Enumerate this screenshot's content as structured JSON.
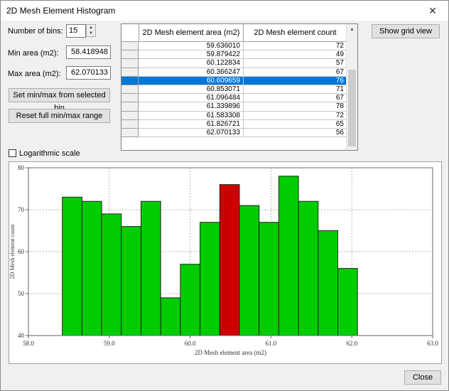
{
  "window": {
    "title": "2D Mesh Element Histogram",
    "close_glyph": "✕"
  },
  "controls": {
    "bins_label": "Number of bins:",
    "bins_value": "15",
    "min_label": "Min area (m2):",
    "min_value": "58.418948",
    "max_label": "Max area (m2):",
    "max_value": "62.070133",
    "set_minmax_button": "Set min/max from selected bin",
    "reset_button": "Reset full min/max range",
    "show_grid_button": "Show grid view",
    "log_label": "Logarithmic scale",
    "close_button": "Close"
  },
  "table": {
    "col1": "2D Mesh element area (m2)",
    "col2": "2D Mesh element count",
    "rows": [
      {
        "area": "59.636010",
        "count": "72"
      },
      {
        "area": "59.879422",
        "count": "49"
      },
      {
        "area": "60.122834",
        "count": "57"
      },
      {
        "area": "60.366247",
        "count": "67"
      },
      {
        "area": "60.609659",
        "count": "76"
      },
      {
        "area": "60.853071",
        "count": "71"
      },
      {
        "area": "61.096484",
        "count": "67"
      },
      {
        "area": "61.339896",
        "count": "78"
      },
      {
        "area": "61.583308",
        "count": "72"
      },
      {
        "area": "61.826721",
        "count": "65"
      },
      {
        "area": "62.070133",
        "count": "56"
      }
    ],
    "selected_index": 4
  },
  "colors": {
    "bar": "#00cc00",
    "bar_selected": "#cc0000",
    "selection": "#0078d7"
  },
  "chart_data": {
    "type": "bar",
    "xlabel": "2D Mesh element area (m2)",
    "ylabel": "2D Mesh element count",
    "xlim": [
      58.0,
      63.0
    ],
    "ylim": [
      40,
      80
    ],
    "xticks": [
      "58.0",
      "59.0",
      "60.0",
      "61.0",
      "62.0",
      "63.0"
    ],
    "yticks": [
      "40",
      "50",
      "60",
      "70",
      "80"
    ],
    "bin_edges": [
      58.418948,
      58.662359,
      58.905771,
      59.149183,
      59.392596,
      59.63601,
      59.879422,
      60.122834,
      60.366247,
      60.609659,
      60.853071,
      61.096484,
      61.339896,
      61.583308,
      61.826721,
      62.070133
    ],
    "values": [
      73,
      72,
      69,
      66,
      72,
      49,
      57,
      67,
      76,
      71,
      67,
      78,
      72,
      65,
      56
    ],
    "selected_bin": 8,
    "grid": true
  }
}
